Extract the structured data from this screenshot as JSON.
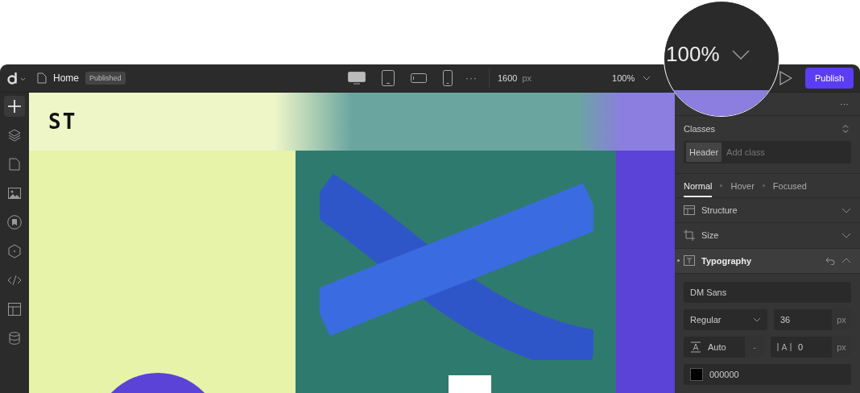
{
  "toolbar": {
    "page": "Home",
    "status_badge": "Published",
    "devices": [
      {
        "kind": "desktop",
        "selected": true
      },
      {
        "kind": "tablet",
        "selected": false
      },
      {
        "kind": "landscape",
        "selected": false
      },
      {
        "kind": "phone",
        "selected": false
      }
    ],
    "more": "···",
    "width_value": "1600",
    "width_unit": "px",
    "zoom": "100%",
    "publish": "Publish"
  },
  "magnifier": {
    "zoom": "100%"
  },
  "sidebar": {
    "items": [
      {
        "kind": "add",
        "selected": true
      },
      {
        "kind": "layers",
        "selected": false
      },
      {
        "kind": "pages",
        "selected": false
      },
      {
        "kind": "media",
        "selected": false
      },
      {
        "kind": "bookmark",
        "selected": false
      },
      {
        "kind": "components",
        "selected": false
      },
      {
        "kind": "code",
        "selected": false
      },
      {
        "kind": "layout",
        "selected": false
      },
      {
        "kind": "data",
        "selected": false
      }
    ]
  },
  "canvas": {
    "logo": "ST"
  },
  "panel": {
    "more": "···",
    "classes_label": "Classes",
    "class_chip": "Header",
    "class_placeholder": "Add class",
    "states": [
      {
        "label": "Normal",
        "selected": true
      },
      {
        "label": "Hover",
        "selected": false
      },
      {
        "label": "Focused",
        "selected": false
      }
    ],
    "sections": [
      {
        "kind": "structure",
        "label": "Structure",
        "expanded": false
      },
      {
        "kind": "size",
        "label": "Size",
        "expanded": false
      },
      {
        "kind": "typography",
        "label": "Typography",
        "expanded": true
      }
    ],
    "typography": {
      "font": "DM Sans",
      "weight": "Regular",
      "size": "36",
      "size_unit": "px",
      "line_height": "Auto",
      "line_height_btn": "-",
      "spacing": "0",
      "spacing_unit": "px",
      "color": "000000"
    }
  }
}
